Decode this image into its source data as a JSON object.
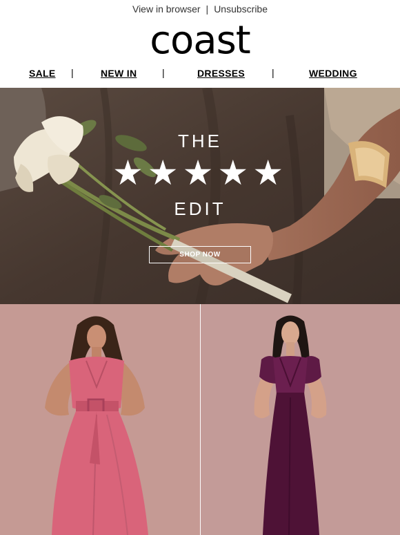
{
  "preheader": {
    "view_in_browser": "View in browser",
    "separator": "|",
    "unsubscribe": "Unsubscribe"
  },
  "brand": {
    "logo_text": "coast"
  },
  "nav": {
    "items": [
      {
        "label": "SALE"
      },
      {
        "label": "NEW IN"
      },
      {
        "label": "DRESSES"
      },
      {
        "label": "WEDDING"
      }
    ],
    "divider": "|"
  },
  "hero": {
    "line1": "THE",
    "stars": "★★★★★",
    "line2": "EDIT",
    "cta": "SHOP NOW"
  },
  "products": [
    {
      "name": "pink-belted-midi-dress",
      "color": "#d9647a"
    },
    {
      "name": "plum-flutter-sleeve-maxi-dress",
      "color": "#4e1236"
    }
  ],
  "colors": {
    "background": "#ffffff",
    "hero_overlay": "#4b3d35",
    "product_backdrop": "#c49a95"
  }
}
